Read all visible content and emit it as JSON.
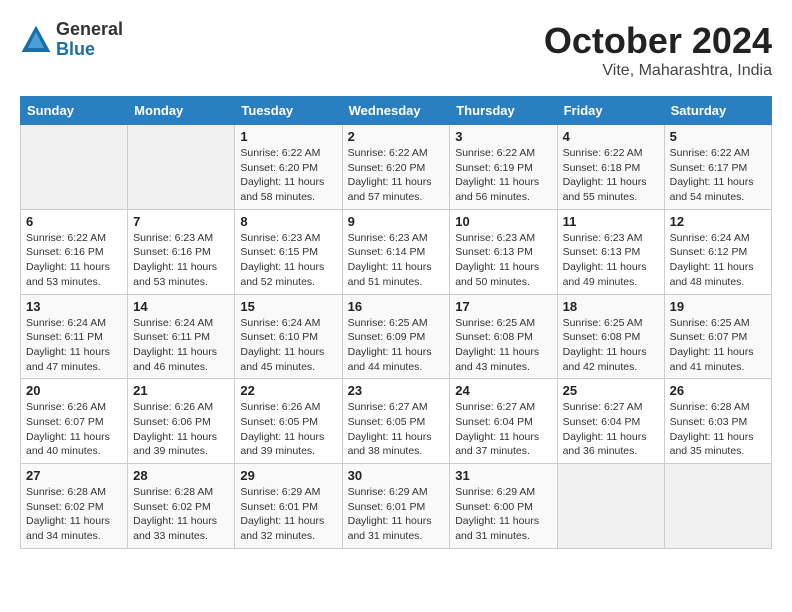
{
  "header": {
    "logo_general": "General",
    "logo_blue": "Blue",
    "month_title": "October 2024",
    "location": "Vite, Maharashtra, India"
  },
  "calendar": {
    "days_of_week": [
      "Sunday",
      "Monday",
      "Tuesday",
      "Wednesday",
      "Thursday",
      "Friday",
      "Saturday"
    ],
    "weeks": [
      [
        {
          "day": "",
          "info": ""
        },
        {
          "day": "",
          "info": ""
        },
        {
          "day": "1",
          "info": "Sunrise: 6:22 AM\nSunset: 6:20 PM\nDaylight: 11 hours and 58 minutes."
        },
        {
          "day": "2",
          "info": "Sunrise: 6:22 AM\nSunset: 6:20 PM\nDaylight: 11 hours and 57 minutes."
        },
        {
          "day": "3",
          "info": "Sunrise: 6:22 AM\nSunset: 6:19 PM\nDaylight: 11 hours and 56 minutes."
        },
        {
          "day": "4",
          "info": "Sunrise: 6:22 AM\nSunset: 6:18 PM\nDaylight: 11 hours and 55 minutes."
        },
        {
          "day": "5",
          "info": "Sunrise: 6:22 AM\nSunset: 6:17 PM\nDaylight: 11 hours and 54 minutes."
        }
      ],
      [
        {
          "day": "6",
          "info": "Sunrise: 6:22 AM\nSunset: 6:16 PM\nDaylight: 11 hours and 53 minutes."
        },
        {
          "day": "7",
          "info": "Sunrise: 6:23 AM\nSunset: 6:16 PM\nDaylight: 11 hours and 53 minutes."
        },
        {
          "day": "8",
          "info": "Sunrise: 6:23 AM\nSunset: 6:15 PM\nDaylight: 11 hours and 52 minutes."
        },
        {
          "day": "9",
          "info": "Sunrise: 6:23 AM\nSunset: 6:14 PM\nDaylight: 11 hours and 51 minutes."
        },
        {
          "day": "10",
          "info": "Sunrise: 6:23 AM\nSunset: 6:13 PM\nDaylight: 11 hours and 50 minutes."
        },
        {
          "day": "11",
          "info": "Sunrise: 6:23 AM\nSunset: 6:13 PM\nDaylight: 11 hours and 49 minutes."
        },
        {
          "day": "12",
          "info": "Sunrise: 6:24 AM\nSunset: 6:12 PM\nDaylight: 11 hours and 48 minutes."
        }
      ],
      [
        {
          "day": "13",
          "info": "Sunrise: 6:24 AM\nSunset: 6:11 PM\nDaylight: 11 hours and 47 minutes."
        },
        {
          "day": "14",
          "info": "Sunrise: 6:24 AM\nSunset: 6:11 PM\nDaylight: 11 hours and 46 minutes."
        },
        {
          "day": "15",
          "info": "Sunrise: 6:24 AM\nSunset: 6:10 PM\nDaylight: 11 hours and 45 minutes."
        },
        {
          "day": "16",
          "info": "Sunrise: 6:25 AM\nSunset: 6:09 PM\nDaylight: 11 hours and 44 minutes."
        },
        {
          "day": "17",
          "info": "Sunrise: 6:25 AM\nSunset: 6:08 PM\nDaylight: 11 hours and 43 minutes."
        },
        {
          "day": "18",
          "info": "Sunrise: 6:25 AM\nSunset: 6:08 PM\nDaylight: 11 hours and 42 minutes."
        },
        {
          "day": "19",
          "info": "Sunrise: 6:25 AM\nSunset: 6:07 PM\nDaylight: 11 hours and 41 minutes."
        }
      ],
      [
        {
          "day": "20",
          "info": "Sunrise: 6:26 AM\nSunset: 6:07 PM\nDaylight: 11 hours and 40 minutes."
        },
        {
          "day": "21",
          "info": "Sunrise: 6:26 AM\nSunset: 6:06 PM\nDaylight: 11 hours and 39 minutes."
        },
        {
          "day": "22",
          "info": "Sunrise: 6:26 AM\nSunset: 6:05 PM\nDaylight: 11 hours and 39 minutes."
        },
        {
          "day": "23",
          "info": "Sunrise: 6:27 AM\nSunset: 6:05 PM\nDaylight: 11 hours and 38 minutes."
        },
        {
          "day": "24",
          "info": "Sunrise: 6:27 AM\nSunset: 6:04 PM\nDaylight: 11 hours and 37 minutes."
        },
        {
          "day": "25",
          "info": "Sunrise: 6:27 AM\nSunset: 6:04 PM\nDaylight: 11 hours and 36 minutes."
        },
        {
          "day": "26",
          "info": "Sunrise: 6:28 AM\nSunset: 6:03 PM\nDaylight: 11 hours and 35 minutes."
        }
      ],
      [
        {
          "day": "27",
          "info": "Sunrise: 6:28 AM\nSunset: 6:02 PM\nDaylight: 11 hours and 34 minutes."
        },
        {
          "day": "28",
          "info": "Sunrise: 6:28 AM\nSunset: 6:02 PM\nDaylight: 11 hours and 33 minutes."
        },
        {
          "day": "29",
          "info": "Sunrise: 6:29 AM\nSunset: 6:01 PM\nDaylight: 11 hours and 32 minutes."
        },
        {
          "day": "30",
          "info": "Sunrise: 6:29 AM\nSunset: 6:01 PM\nDaylight: 11 hours and 31 minutes."
        },
        {
          "day": "31",
          "info": "Sunrise: 6:29 AM\nSunset: 6:00 PM\nDaylight: 11 hours and 31 minutes."
        },
        {
          "day": "",
          "info": ""
        },
        {
          "day": "",
          "info": ""
        }
      ]
    ]
  }
}
